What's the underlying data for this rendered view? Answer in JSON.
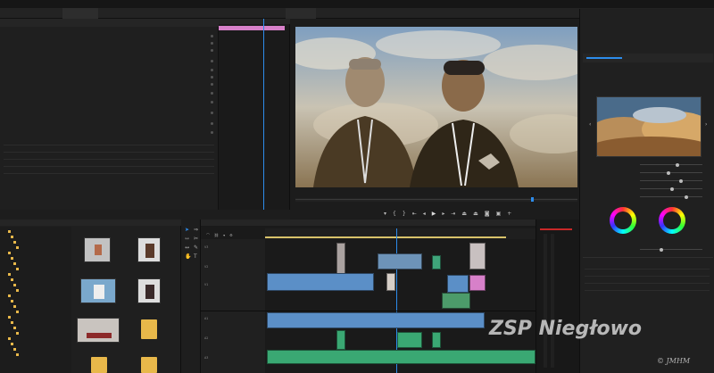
{
  "menubar": {
    "items": [
      "",
      "",
      "",
      "",
      "",
      "",
      "",
      "",
      "",
      "",
      "",
      "",
      "",
      "",
      ""
    ]
  },
  "tabs": {
    "left": [
      "",
      "",
      "",
      "",
      "",
      ""
    ],
    "right": [
      "",
      "",
      "",
      "",
      "",
      ""
    ],
    "active_index": 8
  },
  "effects": {
    "header": "",
    "rows": [
      {
        "label": "",
        "value": ""
      },
      {
        "label": "",
        "value": ""
      },
      {
        "label": "",
        "value": ""
      },
      {
        "label": "",
        "value": ""
      },
      {
        "label": "",
        "value": ""
      },
      {
        "label": "",
        "value": ""
      },
      {
        "label": "",
        "value": ""
      },
      {
        "label": "",
        "value": ""
      },
      {
        "label": "",
        "value": ""
      },
      {
        "label": "",
        "value": ""
      },
      {
        "label": "",
        "value": ""
      },
      {
        "label": "",
        "value": ""
      }
    ]
  },
  "program": {
    "timecode_left": "",
    "timecode_right": "",
    "fit": ""
  },
  "lumetri": {
    "title": "",
    "rows": [
      "",
      "",
      "",
      "",
      "",
      "",
      "",
      "",
      "",
      "",
      "",
      "",
      "",
      ""
    ],
    "wheel_labels": [
      "",
      ""
    ]
  },
  "project": {
    "header": "",
    "tree_items": [
      "",
      "",
      "",
      "",
      "",
      "",
      "",
      "",
      "",
      "",
      "",
      "",
      "",
      "",
      "",
      "",
      "",
      "",
      "",
      "",
      "",
      "",
      "",
      ""
    ],
    "bins": [
      {
        "type": "clip",
        "name": ""
      },
      {
        "type": "clip",
        "name": ""
      },
      {
        "type": "clip",
        "name": ""
      },
      {
        "type": "clip",
        "name": ""
      },
      {
        "type": "clip",
        "name": ""
      },
      {
        "type": "folder",
        "name": ""
      },
      {
        "type": "folder",
        "name": ""
      },
      {
        "type": "folder",
        "name": ""
      }
    ]
  },
  "timeline": {
    "name": "",
    "timecode": "",
    "tracks": [
      "V3",
      "V2",
      "V1",
      "A1",
      "A2",
      "A3"
    ]
  },
  "watermark": {
    "title": "ZSP Niegłowo",
    "sub": "© JMHM"
  },
  "colors": {
    "accent": "#2d8ceb",
    "video_clip": "#5b8fc7",
    "audio_clip": "#3aa873",
    "work_area": "#d780c9",
    "wheel_ring": "conic"
  }
}
